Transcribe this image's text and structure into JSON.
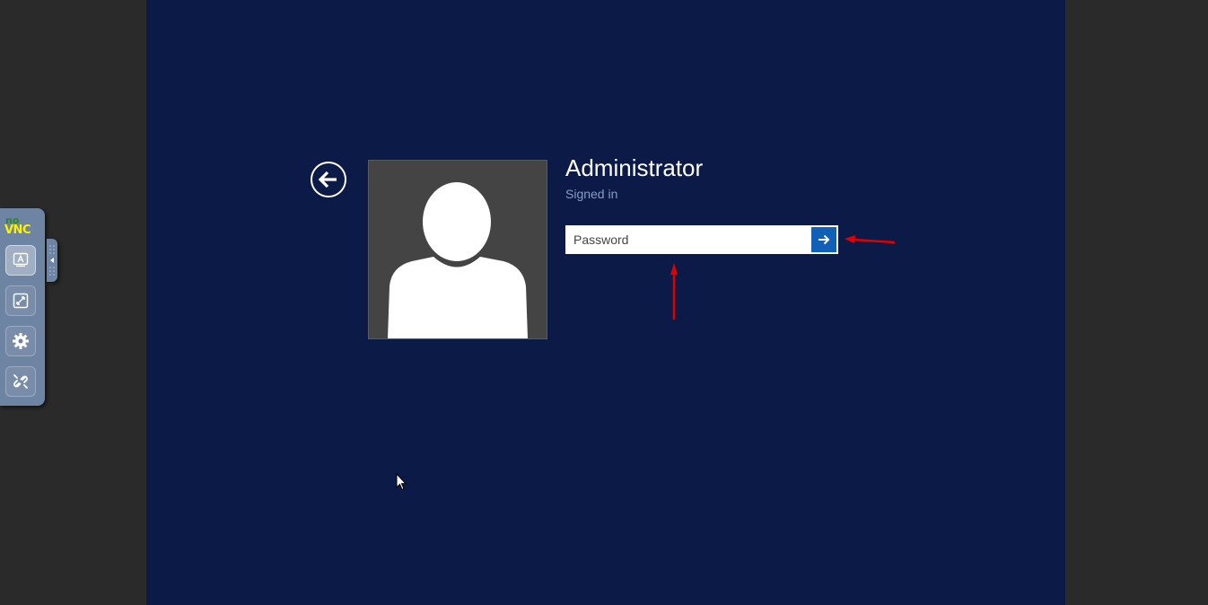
{
  "novnc": {
    "logo_top": "no",
    "logo_bottom": "VNC",
    "buttons": [
      {
        "icon": "keyboard-a-icon"
      },
      {
        "icon": "fullscreen-icon"
      },
      {
        "icon": "gear-icon"
      },
      {
        "icon": "disconnect-icon"
      }
    ],
    "handle_icon": "collapse-arrow-icon"
  },
  "login": {
    "user_name": "Administrator",
    "status": "Signed in",
    "password_placeholder": "Password",
    "password_value": ""
  },
  "colors": {
    "background": "#0b1a47",
    "outer": "#2a2a2a",
    "submit": "#1160b8",
    "annotation": "#e00000",
    "novnc_bar": "#6e84a3"
  }
}
